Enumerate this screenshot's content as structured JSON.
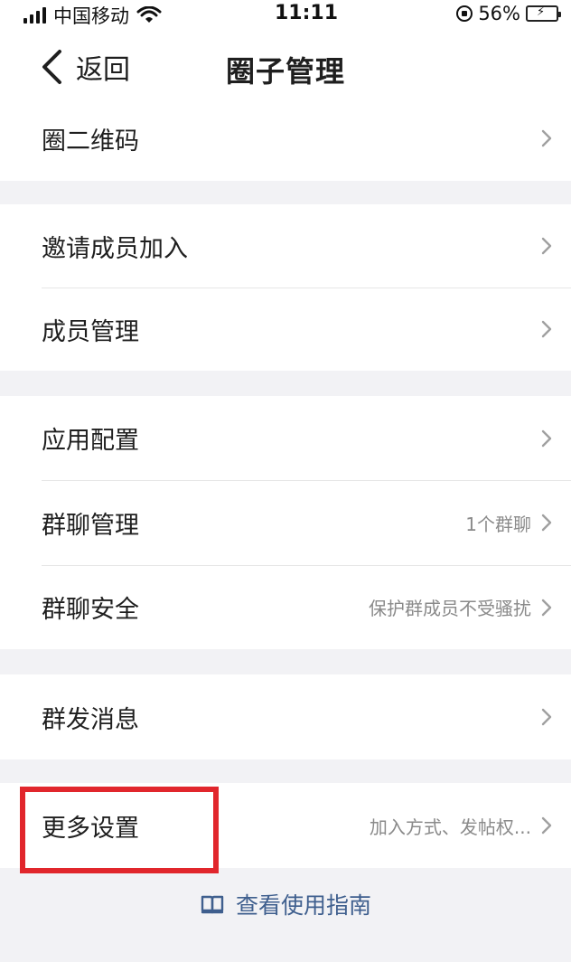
{
  "status_bar": {
    "carrier": "中国移动",
    "time": "11:11",
    "battery": "56%"
  },
  "nav": {
    "back_label": "返回",
    "title": "圈子管理"
  },
  "groups": [
    {
      "rows": [
        {
          "label": "圈二维码",
          "value": ""
        }
      ]
    },
    {
      "rows": [
        {
          "label": "邀请成员加入",
          "value": ""
        },
        {
          "label": "成员管理",
          "value": ""
        }
      ]
    },
    {
      "rows": [
        {
          "label": "应用配置",
          "value": ""
        },
        {
          "label": "群聊管理",
          "value": "1个群聊"
        },
        {
          "label": "群聊安全",
          "value": "保护群成员不受骚扰"
        }
      ]
    },
    {
      "rows": [
        {
          "label": "群发消息",
          "value": ""
        }
      ]
    },
    {
      "rows": [
        {
          "label": "更多设置",
          "value": "加入方式、发帖权..."
        }
      ]
    }
  ],
  "footer": {
    "guide_label": "查看使用指南"
  },
  "colors": {
    "highlight": "#e1262c",
    "link": "#3f5f8e",
    "background": "#f2f2f5"
  },
  "icons": [
    "signal-icon",
    "wifi-icon",
    "rotation-lock-icon",
    "battery-icon",
    "back-chevron-icon",
    "chevron-right-icon",
    "book-icon"
  ]
}
